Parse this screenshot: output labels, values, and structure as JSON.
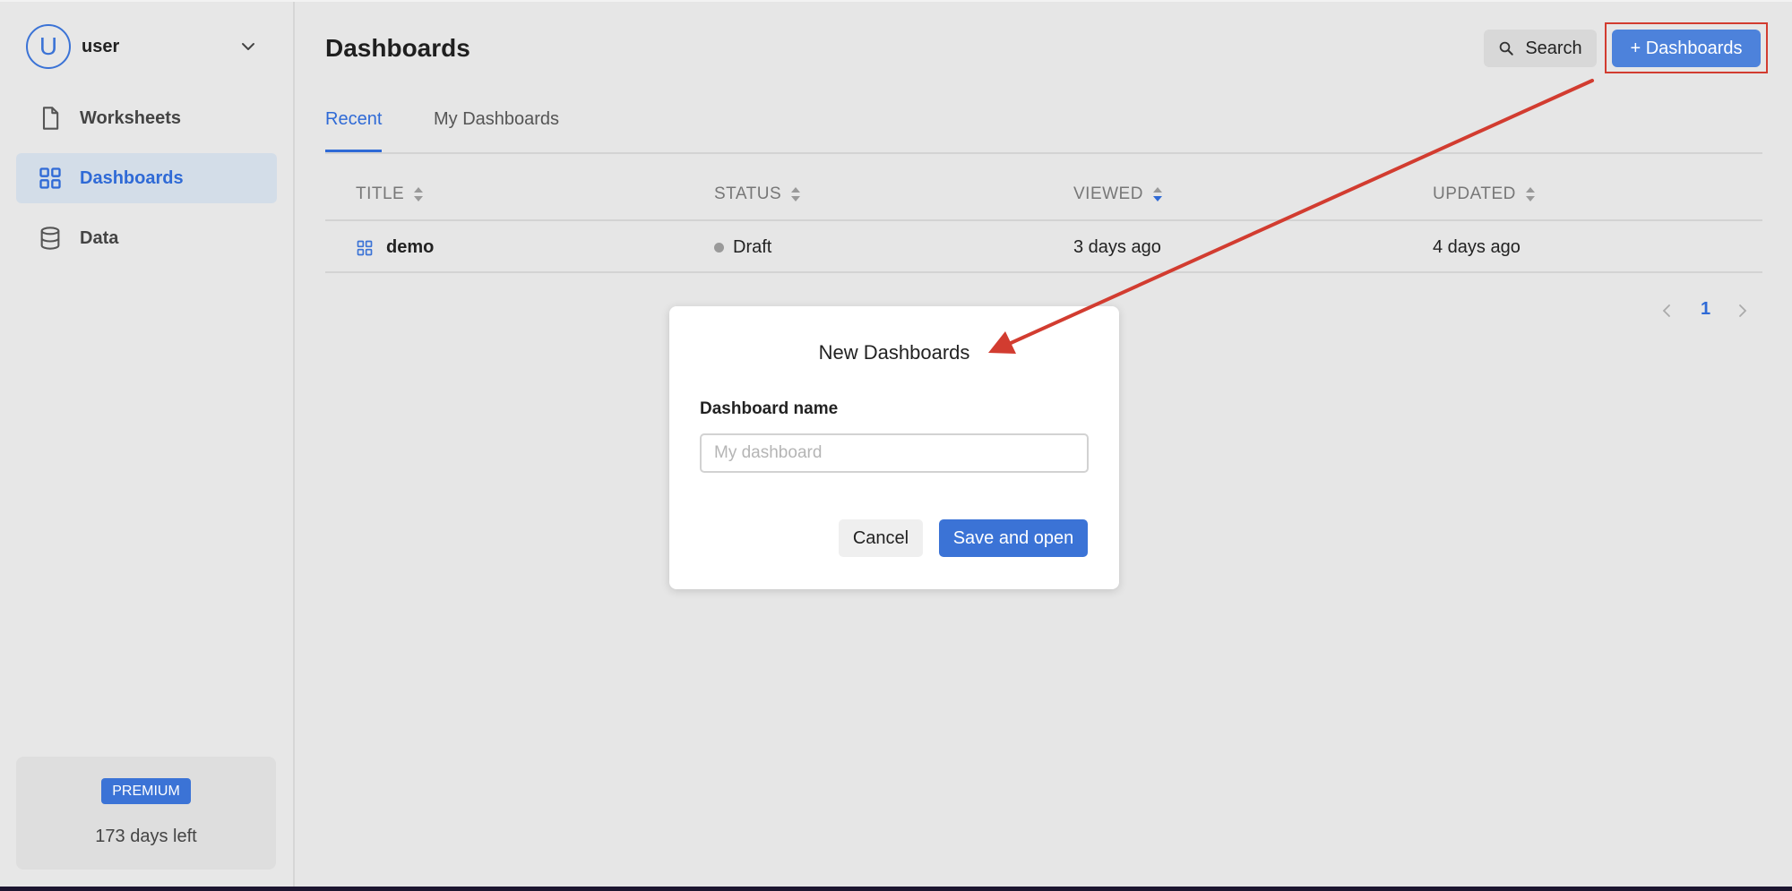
{
  "sidebar": {
    "user": {
      "initial": "U",
      "name": "user"
    },
    "items": [
      {
        "label": "Worksheets",
        "icon": "file-icon"
      },
      {
        "label": "Dashboards",
        "icon": "grid-icon",
        "active": true
      },
      {
        "label": "Data",
        "icon": "database-icon"
      }
    ],
    "premium": {
      "badge": "PREMIUM",
      "days_left": "173 days left"
    }
  },
  "header": {
    "title": "Dashboards",
    "search_label": "Search",
    "new_label": "+ Dashboards"
  },
  "tabs": [
    {
      "label": "Recent",
      "active": true
    },
    {
      "label": "My Dashboards",
      "active": false
    }
  ],
  "table": {
    "columns": [
      "TITLE",
      "STATUS",
      "VIEWED",
      "UPDATED"
    ],
    "rows": [
      {
        "title": "demo",
        "status": "Draft",
        "viewed": "3 days ago",
        "updated": "4 days ago"
      }
    ]
  },
  "pagination": {
    "current": "1"
  },
  "modal": {
    "title": "New Dashboards",
    "field_label": "Dashboard name",
    "placeholder": "My dashboard",
    "value": "",
    "cancel_label": "Cancel",
    "save_label": "Save and open"
  },
  "colors": {
    "accent": "#3b73d6",
    "annotation": "#d23c30"
  }
}
